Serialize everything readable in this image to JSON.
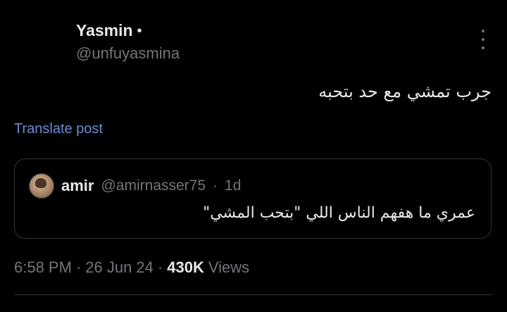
{
  "author": {
    "name": "Yasmin",
    "dot": "•",
    "handle": "@unfuyasmina"
  },
  "post": {
    "text": "جرب تمشي مع حد بتحبه",
    "translate_label": "Translate post"
  },
  "quoted": {
    "name": "amir",
    "handle": "@amirnasser75",
    "separator": "·",
    "age": "1d",
    "text": "عمري ما هفهم الناس اللي \"بتحب المشي\""
  },
  "meta": {
    "time": "6:58 PM",
    "sep1": "·",
    "date": "26 Jun 24",
    "sep2": "·",
    "views_count": "430K",
    "views_label": "Views"
  },
  "colors": {
    "background": "#000000",
    "text": "#e7e9ea",
    "muted": "#71767b",
    "link": "#6b8bd6",
    "border": "#2f3336"
  },
  "icons": {
    "more": "vertical-ellipsis-icon"
  }
}
